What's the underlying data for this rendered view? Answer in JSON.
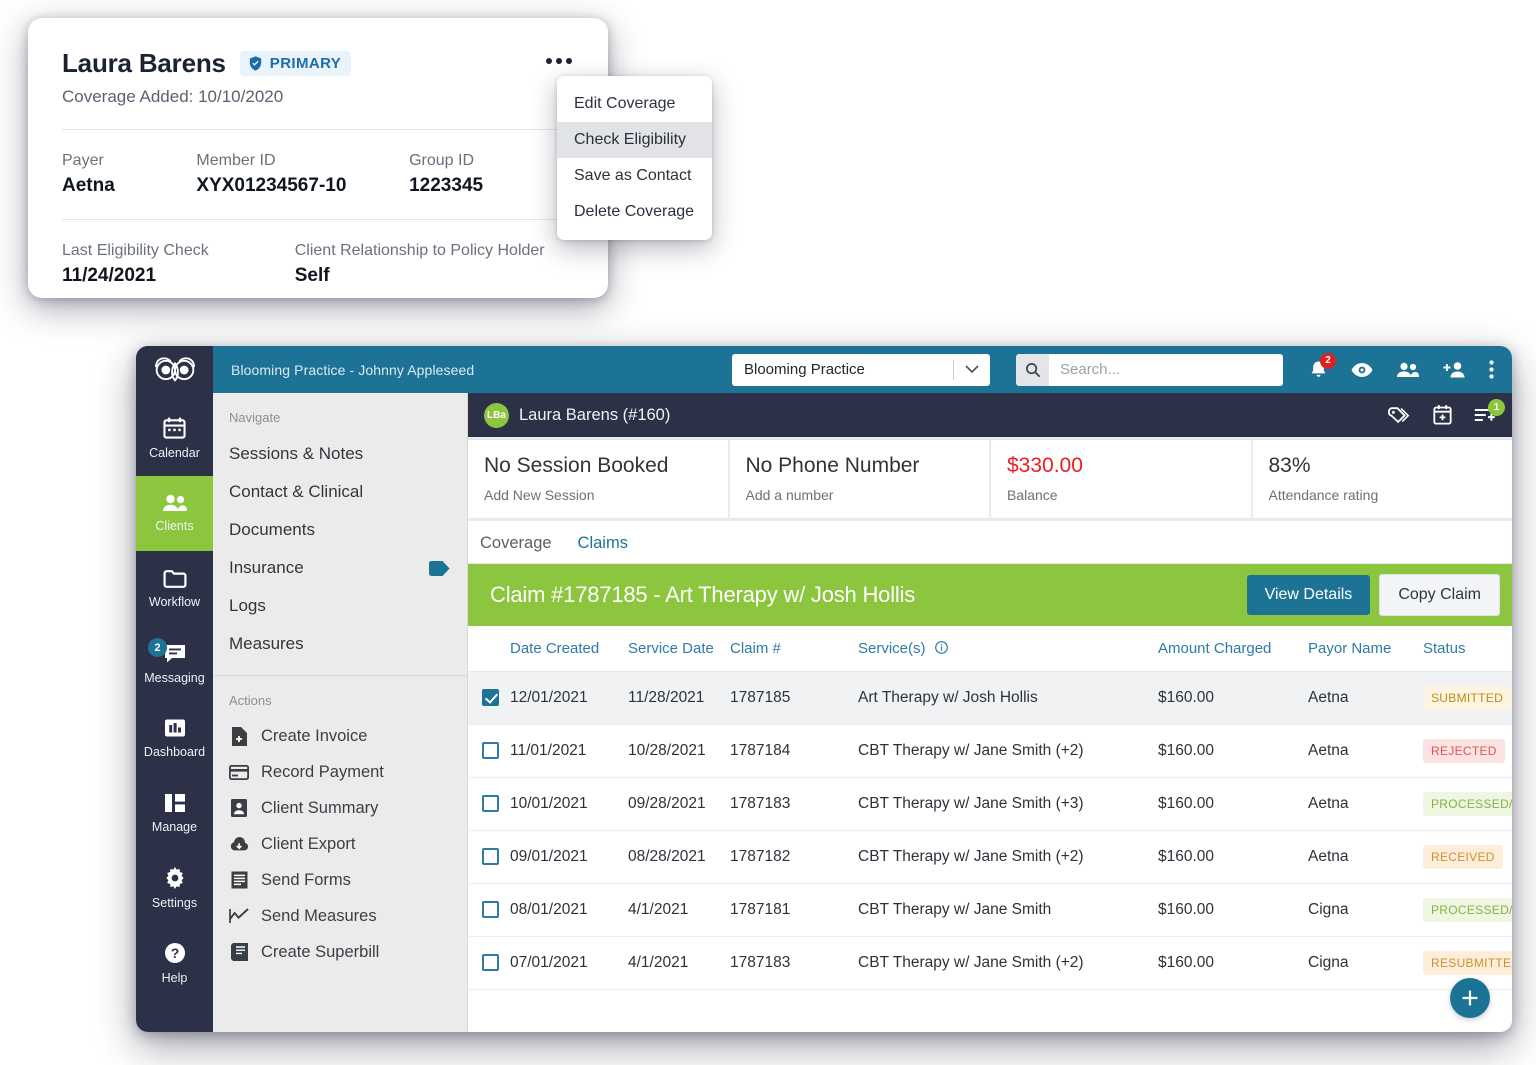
{
  "coverage_card": {
    "client_name": "Laura Barens",
    "primary_badge": "PRIMARY",
    "coverage_added": "Coverage Added: 10/10/2020",
    "fields": [
      {
        "label": "Payer",
        "value": "Aetna"
      },
      {
        "label": "Member ID",
        "value": "XYX01234567-10"
      },
      {
        "label": "Group ID",
        "value": "1223345"
      }
    ],
    "fields_row2": [
      {
        "label": "Last Eligibility Check",
        "value": "11/24/2021"
      },
      {
        "label": "Client Relationship to Policy Holder",
        "value": "Self"
      }
    ]
  },
  "context_menu": {
    "items": [
      {
        "label": "Edit Coverage",
        "active": false
      },
      {
        "label": "Check Eligibility",
        "active": true
      },
      {
        "label": "Save as Contact",
        "active": false
      },
      {
        "label": "Delete Coverage",
        "active": false
      }
    ]
  },
  "topbar": {
    "brand": "Blooming Practice - Johnny Appleseed",
    "practice_selected": "Blooming Practice",
    "search_placeholder": "Search...",
    "notification_count": "2"
  },
  "rail": {
    "items": [
      {
        "label": "Calendar",
        "icon": "calendar-icon",
        "active": false,
        "badge": ""
      },
      {
        "label": "Clients",
        "icon": "people-icon",
        "active": true,
        "badge": ""
      },
      {
        "label": "Workflow",
        "icon": "folder-icon",
        "active": false,
        "badge": ""
      },
      {
        "label": "Messaging",
        "icon": "message-icon",
        "active": false,
        "badge": "2"
      },
      {
        "label": "Dashboard",
        "icon": "chart-icon",
        "active": false,
        "badge": ""
      },
      {
        "label": "Manage",
        "icon": "grid-icon",
        "active": false,
        "badge": ""
      },
      {
        "label": "Settings",
        "icon": "gear-icon",
        "active": false,
        "badge": ""
      },
      {
        "label": "Help",
        "icon": "help-icon",
        "active": false,
        "badge": ""
      }
    ]
  },
  "navpanel": {
    "navigate_title": "Navigate",
    "nav_items": [
      {
        "label": "Sessions & Notes",
        "tag": false
      },
      {
        "label": "Contact & Clinical",
        "tag": false
      },
      {
        "label": "Documents",
        "tag": false
      },
      {
        "label": "Insurance",
        "tag": true
      },
      {
        "label": "Logs",
        "tag": false
      },
      {
        "label": "Measures",
        "tag": false
      }
    ],
    "actions_title": "Actions",
    "actions": [
      {
        "label": "Create Invoice",
        "icon": "file-plus-icon"
      },
      {
        "label": "Record Payment",
        "icon": "credit-card-icon"
      },
      {
        "label": "Client Summary",
        "icon": "person-card-icon"
      },
      {
        "label": "Client Export",
        "icon": "cloud-download-icon"
      },
      {
        "label": "Send Forms",
        "icon": "form-icon"
      },
      {
        "label": "Send Measures",
        "icon": "line-chart-icon"
      },
      {
        "label": "Create Superbill",
        "icon": "receipt-icon"
      }
    ]
  },
  "client_bar": {
    "avatar_initials": "LBa",
    "name": "Laura Barens (#160)",
    "note_badge": "1"
  },
  "stats": [
    {
      "big": "No Session Booked",
      "small": "Add New Session",
      "red": false
    },
    {
      "big": "No Phone Number",
      "small": "Add a number",
      "red": false
    },
    {
      "big": "$330.00",
      "small": "Balance",
      "red": true
    },
    {
      "big": "83%",
      "small": "Attendance rating",
      "red": false
    }
  ],
  "tabs": [
    {
      "label": "Coverage",
      "active": false
    },
    {
      "label": "Claims",
      "active": true
    }
  ],
  "claim_banner": {
    "title": "Claim #1787185 - Art Therapy w/ Josh Hollis",
    "view_details": "View Details",
    "copy_claim": "Copy Claim"
  },
  "claims_table": {
    "headers": [
      "Date Created",
      "Service Date",
      "Claim #",
      "Service(s)",
      "Amount Charged",
      "Payor Name",
      "Status"
    ],
    "rows": [
      {
        "checked": true,
        "date_created": "12/01/2021",
        "service_date": "11/28/2021",
        "claim_no": "1787185",
        "service": "Art Therapy w/ Josh Hollis",
        "amount": "$160.00",
        "payor": "Aetna",
        "status": "SUBMITTED",
        "status_class": "submitted"
      },
      {
        "checked": false,
        "date_created": "11/01/2021",
        "service_date": "10/28/2021",
        "claim_no": "1787184",
        "service": "CBT Therapy w/ Jane Smith (+2)",
        "amount": "$160.00",
        "payor": "Aetna",
        "status": "REJECTED",
        "status_class": "rejected"
      },
      {
        "checked": false,
        "date_created": "10/01/2021",
        "service_date": "09/28/2021",
        "claim_no": "1787183",
        "service": "CBT Therapy w/ Jane Smith (+3)",
        "amount": "$160.00",
        "payor": "Aetna",
        "status": "PROCESSED/PAID",
        "status_class": "paid"
      },
      {
        "checked": false,
        "date_created": "09/01/2021",
        "service_date": "08/28/2021",
        "claim_no": "1787182",
        "service": "CBT Therapy w/ Jane Smith (+2)",
        "amount": "$160.00",
        "payor": "Aetna",
        "status": "RECEIVED",
        "status_class": "received"
      },
      {
        "checked": false,
        "date_created": "08/01/2021",
        "service_date": "4/1/2021",
        "claim_no": "1787181",
        "service": "CBT Therapy w/ Jane Smith",
        "amount": "$160.00",
        "payor": "Cigna",
        "status": "PROCESSED/PAID",
        "status_class": "paid"
      },
      {
        "checked": false,
        "date_created": "07/01/2021",
        "service_date": "4/1/2021",
        "claim_no": "1787183",
        "service": "CBT Therapy w/ Jane Smith (+2)",
        "amount": "$160.00",
        "payor": "Cigna",
        "status": "RESUBMITTED",
        "status_class": "resubmitted"
      }
    ]
  },
  "colors": {
    "brand_teal": "#1d7396",
    "brand_green": "#8cc63e",
    "dark_navy": "#2c3147",
    "balance_red": "#ec1c24"
  }
}
